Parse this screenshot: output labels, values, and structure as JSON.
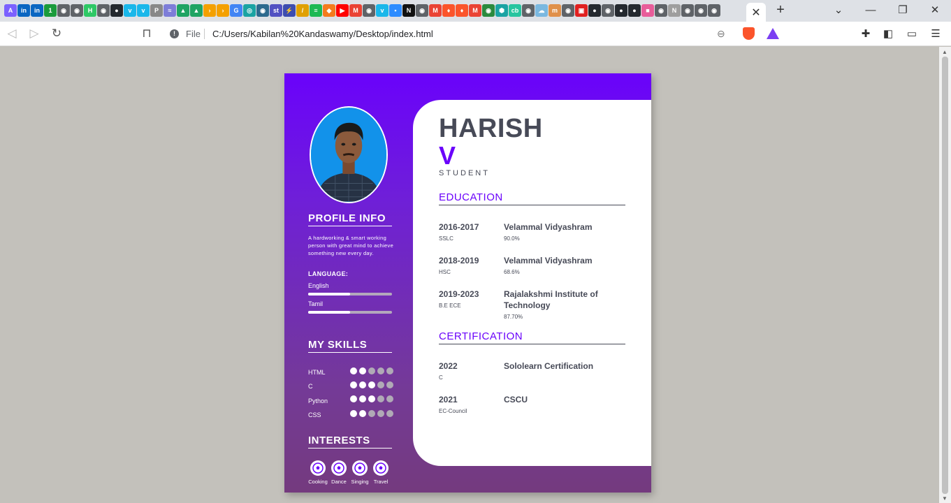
{
  "browser": {
    "active_tab_close": "✕",
    "new_tab": "+",
    "file_label": "File",
    "url": "C:/Users/Kabilan%20Kandaswamy/Desktop/index.html",
    "tab_favicons": [
      {
        "name": "perplexity-favicon",
        "glyph": "A",
        "color": "#7b61ff"
      },
      {
        "name": "linkedin-favicon",
        "glyph": "in",
        "color": "#0a66c2"
      },
      {
        "name": "linkedin-favicon",
        "glyph": "in",
        "color": "#0a66c2"
      },
      {
        "name": "one-favicon",
        "glyph": "1",
        "color": "#1a9b3c"
      },
      {
        "name": "globe-favicon",
        "glyph": "◉",
        "color": "#5f6368"
      },
      {
        "name": "globe-favicon",
        "glyph": "◉",
        "color": "#5f6368"
      },
      {
        "name": "hackerrank-favicon",
        "glyph": "H",
        "color": "#2ec866"
      },
      {
        "name": "globe-favicon",
        "glyph": "◉",
        "color": "#5f6368"
      },
      {
        "name": "github-favicon",
        "glyph": "●",
        "color": "#24292f"
      },
      {
        "name": "vimeo-favicon",
        "glyph": "v",
        "color": "#1ab7ea"
      },
      {
        "name": "vimeo-favicon",
        "glyph": "v",
        "color": "#1ab7ea"
      },
      {
        "name": "pega-favicon",
        "glyph": "P",
        "color": "#888888"
      },
      {
        "name": "wave-favicon",
        "glyph": "≈",
        "color": "#7d7dd8"
      },
      {
        "name": "drive-favicon",
        "glyph": "▲",
        "color": "#1fa463"
      },
      {
        "name": "drive-favicon",
        "glyph": "▲",
        "color": "#1fa463"
      },
      {
        "name": "arrow-favicon",
        "glyph": "›",
        "color": "#f4a000"
      },
      {
        "name": "arrow-favicon",
        "glyph": "›",
        "color": "#f4a000"
      },
      {
        "name": "google-favicon",
        "glyph": "G",
        "color": "#4285f4"
      },
      {
        "name": "dot-favicon",
        "glyph": "◎",
        "color": "#1aa3a3"
      },
      {
        "name": "dot-favicon",
        "glyph": "◉",
        "color": "#2d6a8e"
      },
      {
        "name": "st-favicon",
        "glyph": "st",
        "color": "#5151c2"
      },
      {
        "name": "bolt-favicon",
        "glyph": "⚡",
        "color": "#3d4db0"
      },
      {
        "name": "slash-favicon",
        "glyph": "/",
        "color": "#e0a000"
      },
      {
        "name": "spotify-favicon",
        "glyph": "≡",
        "color": "#1db954"
      },
      {
        "name": "box-favicon",
        "glyph": "◆",
        "color": "#f47b1d"
      },
      {
        "name": "youtube-favicon",
        "glyph": "▶",
        "color": "#ff0000"
      },
      {
        "name": "gmail-favicon",
        "glyph": "M",
        "color": "#ea4335"
      },
      {
        "name": "globe-favicon",
        "glyph": "◉",
        "color": "#5f6368"
      },
      {
        "name": "vimeo-favicon",
        "glyph": "v",
        "color": "#1ab7ea"
      },
      {
        "name": "zoom-favicon",
        "glyph": "▪",
        "color": "#2d8cff"
      },
      {
        "name": "ni-favicon",
        "glyph": "N",
        "color": "#111111"
      },
      {
        "name": "globe-favicon",
        "glyph": "◉",
        "color": "#5f6368"
      },
      {
        "name": "gmail-favicon",
        "glyph": "M",
        "color": "#ea4335"
      },
      {
        "name": "brave-favicon",
        "glyph": "♦",
        "color": "#fb542b"
      },
      {
        "name": "brave-favicon",
        "glyph": "♦",
        "color": "#fb542b"
      },
      {
        "name": "gmail-favicon",
        "glyph": "M",
        "color": "#ea4335"
      },
      {
        "name": "globe-favicon",
        "glyph": "◉",
        "color": "#2b8a3e"
      },
      {
        "name": "hex-favicon",
        "glyph": "⬢",
        "color": "#1aa3a3"
      },
      {
        "name": "cb-favicon",
        "glyph": "cb",
        "color": "#27c5a0"
      },
      {
        "name": "globe-favicon",
        "glyph": "◉",
        "color": "#5f6368"
      },
      {
        "name": "cloud-favicon",
        "glyph": "☁",
        "color": "#7ab8e0"
      },
      {
        "name": "m-favicon",
        "glyph": "m",
        "color": "#e0904a"
      },
      {
        "name": "globe-favicon",
        "glyph": "◉",
        "color": "#5f6368"
      },
      {
        "name": "pdf-favicon",
        "glyph": "▣",
        "color": "#e02020"
      },
      {
        "name": "github-favicon",
        "glyph": "●",
        "color": "#24292f"
      },
      {
        "name": "globe-favicon",
        "glyph": "◉",
        "color": "#5f6368"
      },
      {
        "name": "github-favicon",
        "glyph": "●",
        "color": "#24292f"
      },
      {
        "name": "github-favicon",
        "glyph": "●",
        "color": "#24292f"
      },
      {
        "name": "palette-favicon",
        "glyph": "■",
        "color": "#e85d9a"
      },
      {
        "name": "globe-favicon",
        "glyph": "◉",
        "color": "#5f6368"
      },
      {
        "name": "n-favicon",
        "glyph": "N",
        "color": "#9e9e9e"
      },
      {
        "name": "globe-favicon",
        "glyph": "◉",
        "color": "#5f6368"
      },
      {
        "name": "globe-favicon",
        "glyph": "◉",
        "color": "#5f6368"
      },
      {
        "name": "globe-favicon",
        "glyph": "◉",
        "color": "#5f6368"
      }
    ]
  },
  "colors": {
    "accent": "#6a02fb",
    "text": "#474a57",
    "sidebar_bottom": "#743a7e"
  },
  "resume": {
    "first_name": "HARISH",
    "last_name": "V",
    "role": "STUDENT",
    "profile": {
      "heading": "PROFILE INFO",
      "text": "A hardworking & smart working person with great mind to achieve something new every day.",
      "language_heading": "LANGUAGE:",
      "languages": [
        {
          "name": "English",
          "level": 0.5
        },
        {
          "name": "Tamil",
          "level": 0.5
        }
      ]
    },
    "skills": {
      "heading": "MY SKILLS",
      "items": [
        {
          "name": "HTML",
          "rating": 2,
          "max": 5
        },
        {
          "name": "C",
          "rating": 3,
          "max": 5
        },
        {
          "name": "Python",
          "rating": 3,
          "max": 5
        },
        {
          "name": "CSS",
          "rating": 2,
          "max": 5
        }
      ]
    },
    "interests": {
      "heading": "INTERESTS",
      "items": [
        "Cooking",
        "Dance",
        "Singing",
        "Travel"
      ],
      "icon": "soccer-ball-icon"
    },
    "education": {
      "heading": "EDUCATION",
      "items": [
        {
          "years": "2016-2017",
          "level": "SSLC",
          "institution": "Velammal Vidyashram",
          "score": "90.0%"
        },
        {
          "years": "2018-2019",
          "level": "HSC",
          "institution": "Velammal Vidyashram",
          "score": "68.6%"
        },
        {
          "years": "2019-2023",
          "level": "B.E ECE",
          "institution": "Rajalakshmi Institute of Technology",
          "score": "87.70%"
        }
      ]
    },
    "certification": {
      "heading": "CERTIFICATION",
      "items": [
        {
          "year": "2022",
          "subject": "C",
          "name": "Sololearn Certification"
        },
        {
          "year": "2021",
          "subject": "EC-Council",
          "name": "CSCU"
        }
      ]
    }
  }
}
